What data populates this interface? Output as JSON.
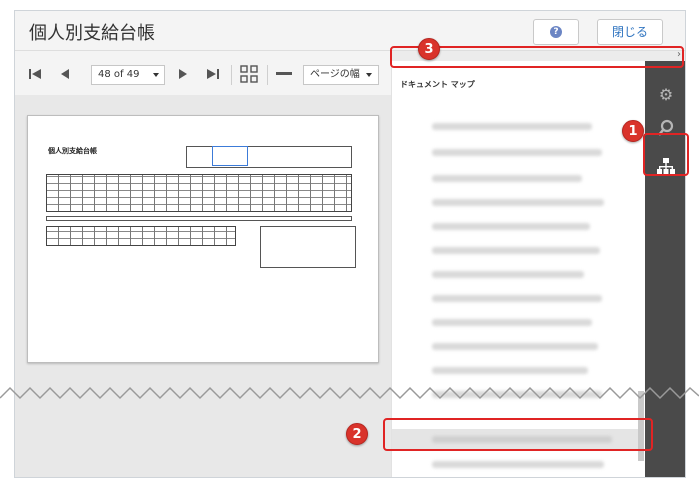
{
  "window": {
    "title": "個人別支給台帳"
  },
  "header": {
    "close_label": "閉じる",
    "help_icon": "help-icon"
  },
  "toolbar": {
    "page_value": "48 of 49",
    "zoom_value": "ページの幅",
    "icons": [
      "first-page-icon",
      "prev-page-icon",
      "next-page-icon",
      "last-page-icon",
      "layout-icon",
      "zoom-out-icon"
    ]
  },
  "document": {
    "title": "個人別支給台帳"
  },
  "docmap": {
    "title": "ドキュメント マップ"
  },
  "sidebar": {
    "icons": [
      "gear-icon",
      "search-icon",
      "document-map-icon"
    ]
  },
  "callouts": {
    "one": "1",
    "two": "2",
    "three": "3"
  },
  "colors": {
    "highlight": "#e02424",
    "sidebar": "#4a4a4a",
    "link": "#2f74c0"
  }
}
